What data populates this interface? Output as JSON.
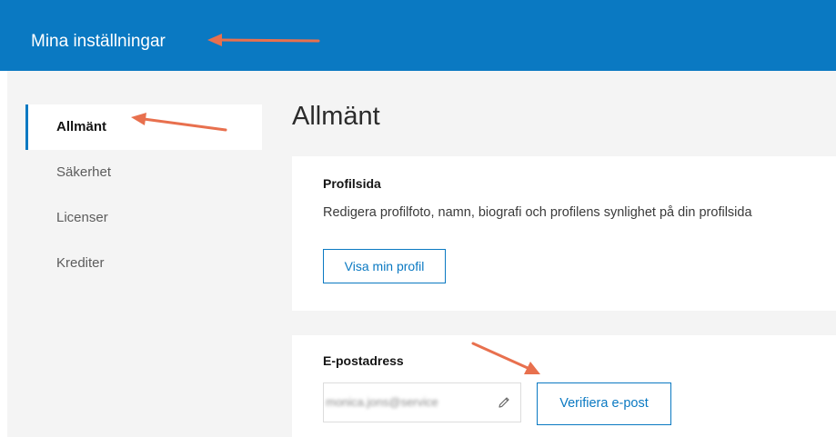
{
  "header": {
    "title": "Mina inställningar"
  },
  "sidebar": {
    "items": [
      {
        "label": "Allmänt",
        "active": true
      },
      {
        "label": "Säkerhet",
        "active": false
      },
      {
        "label": "Licenser",
        "active": false
      },
      {
        "label": "Krediter",
        "active": false
      }
    ]
  },
  "main": {
    "title": "Allmänt",
    "profile_card": {
      "heading": "Profilsida",
      "description": "Redigera profilfoto, namn, biografi och profilens synlighet på din profilsida",
      "button_label": "Visa min profil"
    },
    "email_card": {
      "heading": "E-postadress",
      "email_value": "monica.jons@service",
      "edit_icon": "pencil-icon",
      "verify_button_label": "Verifiera e-post"
    }
  },
  "colors": {
    "brand": "#0a79c2",
    "annotation_arrow": "#e8704e",
    "background": "#f4f4f4",
    "card": "#ffffff"
  }
}
